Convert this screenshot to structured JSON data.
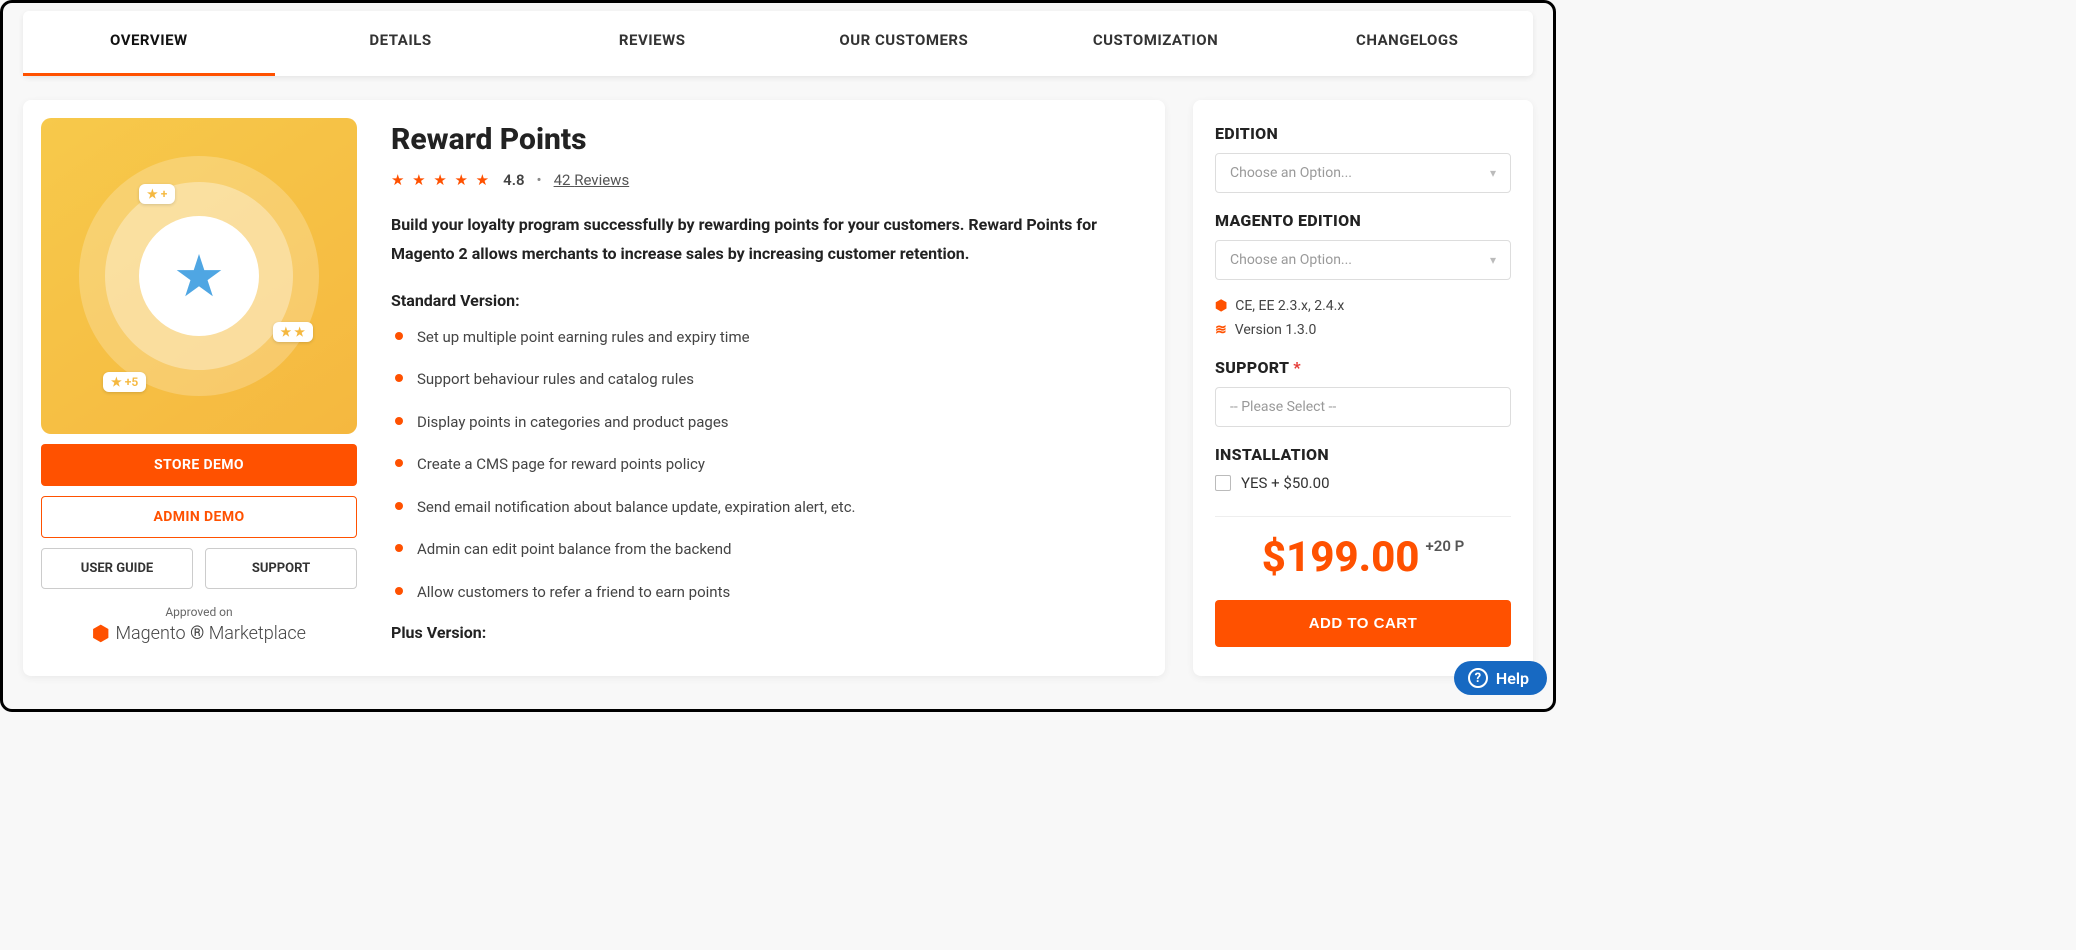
{
  "tabs": {
    "overview": "OVERVIEW",
    "details": "DETAILS",
    "reviews": "REVIEWS",
    "our_customers": "OUR CUSTOMERS",
    "customization": "CUSTOMIZATION",
    "changelogs": "CHANGELOGS"
  },
  "product": {
    "title": "Reward Points",
    "rating": "4.8",
    "reviews_count": "42",
    "reviews_word": "Reviews",
    "dot": "•",
    "lead": "Build your loyalty program successfully by rewarding points for your customers. Reward Points for Magento 2 allows merchants to increase sales by increasing customer retention.",
    "standard_version_label": "Standard Version:",
    "features": [
      "Set up multiple point earning rules and expiry time",
      "Support behaviour rules and catalog rules",
      "Display points in categories and product pages",
      "Create a CMS page for reward points policy",
      "Send email notification about balance update, expiration alert, etc.",
      "Admin can edit point balance from the backend",
      "Allow customers to refer a friend to earn points"
    ],
    "plus_version_label": "Plus Version:",
    "image_chips": {
      "top": "★ +",
      "right": "★ ★",
      "left": "★ +5"
    }
  },
  "buttons": {
    "store_demo": "STORE DEMO",
    "admin_demo": "ADMIN DEMO",
    "user_guide": "USER GUIDE",
    "support": "SUPPORT",
    "add_to_cart": "ADD TO CART"
  },
  "approved": {
    "label": "Approved on",
    "logo_brand": "Magento",
    "logo_text": "Marketplace"
  },
  "sidebar": {
    "edition_label": "EDITION",
    "edition_placeholder": "Choose an Option...",
    "magento_edition_label": "MAGENTO EDITION",
    "magento_edition_placeholder": "Choose an Option...",
    "compatibility": "CE, EE 2.3.x, 2.4.x",
    "version": "Version 1.3.0",
    "support_label": "SUPPORT",
    "support_required_mark": "*",
    "support_placeholder": "-- Please Select --",
    "installation_label": "INSTALLATION",
    "installation_option": "YES + $50.00",
    "price": "$199.00",
    "bonus_points": "+20 P"
  },
  "help": {
    "label": "Help"
  }
}
